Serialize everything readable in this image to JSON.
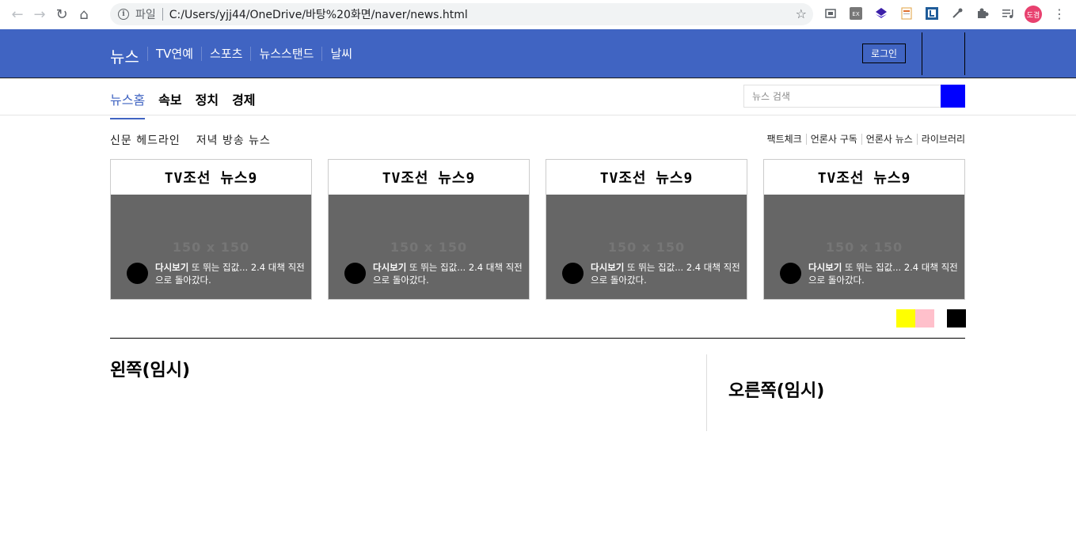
{
  "browser": {
    "scheme": "파일",
    "url": "C:/Users/yjj44/OneDrive/바탕%20화면/naver/news.html",
    "profile_initials": "도겸",
    "ext_ex_label": "EX"
  },
  "header": {
    "logo": "뉴스",
    "menu": [
      "TV연예",
      "스포츠",
      "뉴스스탠드",
      "날씨"
    ],
    "login_label": "로그인"
  },
  "subnav": {
    "tabs": [
      "뉴스홈",
      "속보",
      "정치",
      "경제"
    ],
    "search_placeholder": "뉴스 검색"
  },
  "section": {
    "tabs": [
      "신문 헤드라인",
      "저녁 방송 뉴스"
    ],
    "links": [
      "팩트체크",
      "언론사 구독",
      "언론사 뉴스",
      "라이브러리"
    ]
  },
  "cards": [
    {
      "title": "TV조선 뉴스9",
      "placeholder": "150 x 150",
      "caption_bold": "다시보기",
      "caption": " 또 뛰는 집값... 2.4 대책 직전으로 돌아갔다."
    },
    {
      "title": "TV조선 뉴스9",
      "placeholder": "150 x 150",
      "caption_bold": "다시보기",
      "caption": " 또 뛰는 집값... 2.4 대책 직전으로 돌아갔다."
    },
    {
      "title": "TV조선 뉴스9",
      "placeholder": "150 x 150",
      "caption_bold": "다시보기",
      "caption": " 또 뛰는 집값... 2.4 대책 직전으로 돌아갔다."
    },
    {
      "title": "TV조선 뉴스9",
      "placeholder": "150 x 150",
      "caption_bold": "다시보기",
      "caption": " 또 뛰는 집값... 2.4 대책 직전으로 돌아갔다."
    }
  ],
  "pager_colors": [
    "#ffff00",
    "#ffc0cb",
    "#000000"
  ],
  "main": {
    "left_title": "왼쪽(임시)",
    "right_title": "오른쪽(임시)"
  },
  "colors": {
    "header_bg": "#4064c2",
    "search_button": "#0000ff"
  }
}
